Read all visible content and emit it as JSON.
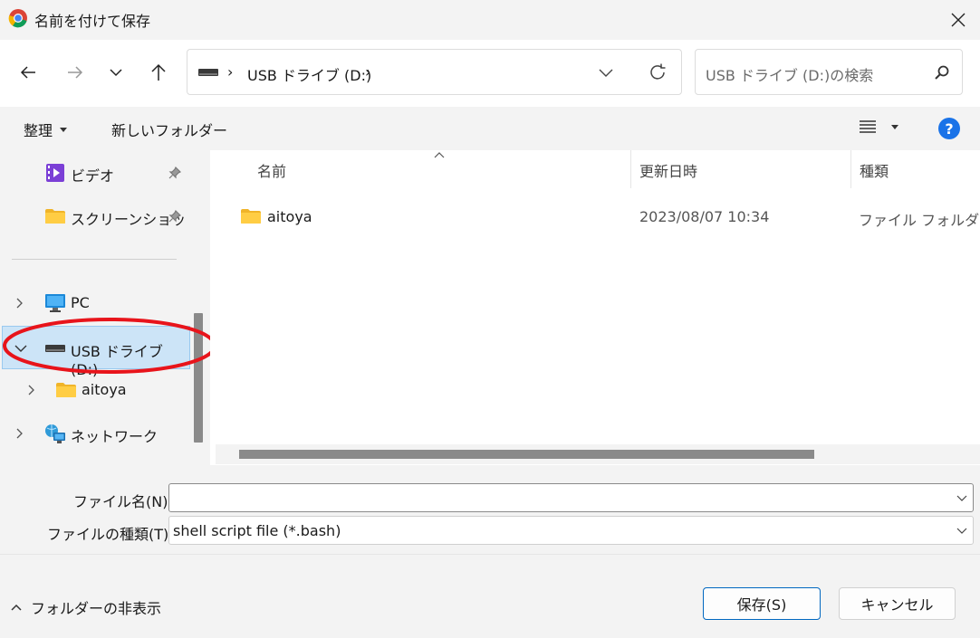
{
  "window": {
    "title": "名前を付けて保存",
    "app_icon": "chrome-icon",
    "close_icon": "close-icon"
  },
  "nav": {
    "address_path": [
      "USB ドライブ (D:)"
    ],
    "search_placeholder": "USB ドライブ (D:)の検索"
  },
  "toolbar": {
    "organize_label": "整理",
    "new_folder_label": "新しいフォルダー"
  },
  "sidebar": {
    "items": [
      {
        "label": "ビデオ",
        "icon": "video-icon",
        "pinned": true
      },
      {
        "label": "スクリーンショッ",
        "icon": "folder-icon",
        "pinned": true
      },
      {
        "label": "PC",
        "icon": "pc-icon"
      },
      {
        "label": "USB ドライブ (D:)",
        "icon": "drive-icon",
        "selected": true,
        "expanded": true
      },
      {
        "label": "aitoya",
        "icon": "folder-icon"
      },
      {
        "label": "ネットワーク",
        "icon": "network-icon"
      }
    ]
  },
  "file_list": {
    "columns": [
      "名前",
      "更新日時",
      "種類"
    ],
    "rows": [
      {
        "name": "aitoya",
        "modified": "2023/08/07 10:34",
        "type": "ファイル フォルダー"
      }
    ]
  },
  "form": {
    "filename_label": "ファイル名(N):",
    "filename_value": "",
    "filetype_label": "ファイルの種類(T):",
    "filetype_value": "shell script file (*.bash)"
  },
  "footer": {
    "hide_folders_label": "フォルダーの非表示",
    "save_label": "保存(S)",
    "cancel_label": "キャンセル"
  },
  "colors": {
    "accent": "#0067c0",
    "selection": "#cce4f7",
    "annotation_circle": "#e8141b",
    "help": "#1a73e8"
  }
}
